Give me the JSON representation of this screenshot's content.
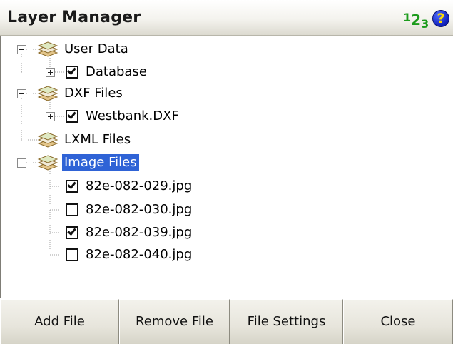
{
  "window": {
    "title": "Layer Manager",
    "input_mode": {
      "sup": "1",
      "main": "2",
      "sub": "3"
    },
    "help_icon": "help-icon"
  },
  "tree": {
    "nodes": [
      {
        "label": "User Data",
        "expanded": true,
        "icon": "layer-stack-icon"
      },
      {
        "label": "Database",
        "checked": true,
        "collapsed": true
      },
      {
        "label": "DXF Files",
        "expanded": true,
        "icon": "layer-stack-icon"
      },
      {
        "label": "Westbank.DXF",
        "checked": true,
        "collapsed": true
      },
      {
        "label": "LXML Files",
        "icon": "layer-stack-icon"
      },
      {
        "label": "Image Files",
        "expanded": true,
        "selected": true,
        "icon": "layer-stack-icon"
      },
      {
        "label": "82e-082-029.jpg",
        "checked": true
      },
      {
        "label": "82e-082-030.jpg",
        "checked": false
      },
      {
        "label": "82e-082-039.jpg",
        "checked": true
      },
      {
        "label": "82e-082-040.jpg",
        "checked": false
      }
    ]
  },
  "buttons": {
    "add_file": "Add File",
    "remove_file": "Remove File",
    "file_settings": "File Settings",
    "close": "Close"
  },
  "colors": {
    "selection": "#2f63d6",
    "input_mode": "#1c9b1c",
    "help_icon": "#1020b8"
  }
}
